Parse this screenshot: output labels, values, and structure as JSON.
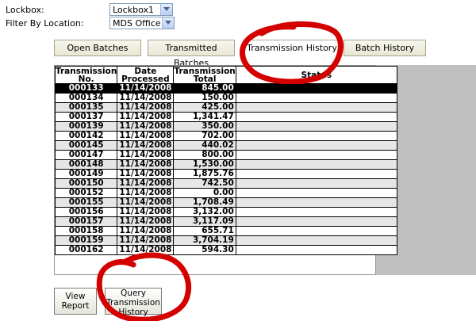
{
  "filters": {
    "lockbox_label": "Lockbox:",
    "lockbox_value": "Lockbox1",
    "location_label": "Filter By Location:",
    "location_value": "MDS Office"
  },
  "tabs": [
    {
      "label": "Open Batches",
      "active": false
    },
    {
      "label": "Transmitted Batches",
      "active": false
    },
    {
      "label": "Transmission History",
      "active": true
    },
    {
      "label": "Batch History",
      "active": false
    }
  ],
  "grid": {
    "headers": {
      "no_line1": "Transmission",
      "no_line2": "No.",
      "date_line1": "Date",
      "date_line2": "Processed",
      "total_line1": "Transmission",
      "total_line2": "Total",
      "status": "Status"
    },
    "rows": [
      {
        "no": "000133",
        "date": "11/14/2008",
        "total": "845.00",
        "status": ""
      },
      {
        "no": "000134",
        "date": "11/14/2008",
        "total": "150.00",
        "status": ""
      },
      {
        "no": "000135",
        "date": "11/14/2008",
        "total": "425.00",
        "status": ""
      },
      {
        "no": "000137",
        "date": "11/14/2008",
        "total": "1,341.47",
        "status": ""
      },
      {
        "no": "000139",
        "date": "11/14/2008",
        "total": "350.00",
        "status": ""
      },
      {
        "no": "000142",
        "date": "11/14/2008",
        "total": "702.00",
        "status": ""
      },
      {
        "no": "000145",
        "date": "11/14/2008",
        "total": "440.02",
        "status": ""
      },
      {
        "no": "000147",
        "date": "11/14/2008",
        "total": "800.00",
        "status": ""
      },
      {
        "no": "000148",
        "date": "11/14/2008",
        "total": "1,530.00",
        "status": ""
      },
      {
        "no": "000149",
        "date": "11/14/2008",
        "total": "1,875.76",
        "status": ""
      },
      {
        "no": "000150",
        "date": "11/14/2008",
        "total": "742.50",
        "status": ""
      },
      {
        "no": "000152",
        "date": "11/14/2008",
        "total": "0.00",
        "status": ""
      },
      {
        "no": "000155",
        "date": "11/14/2008",
        "total": "1,708.49",
        "status": ""
      },
      {
        "no": "000156",
        "date": "11/14/2008",
        "total": "3,132.00",
        "status": ""
      },
      {
        "no": "000157",
        "date": "11/14/2008",
        "total": "3,117.09",
        "status": ""
      },
      {
        "no": "000158",
        "date": "11/14/2008",
        "total": "655.71",
        "status": ""
      },
      {
        "no": "000159",
        "date": "11/14/2008",
        "total": "3,704.19",
        "status": ""
      },
      {
        "no": "000162",
        "date": "11/14/2008",
        "total": "594.30",
        "status": ""
      }
    ],
    "selected_row_index": 0
  },
  "buttons": {
    "view_report_line1": "View",
    "view_report_line2": "Report",
    "query_line1": "Query",
    "query_line2": "Transmission",
    "query_line3": "History"
  },
  "colors": {
    "annotation_red": "#d40000",
    "selected_row_bg": "#000000",
    "alt_row_bg": "#e6e6e6",
    "side_panel": "#c0c0c0"
  }
}
